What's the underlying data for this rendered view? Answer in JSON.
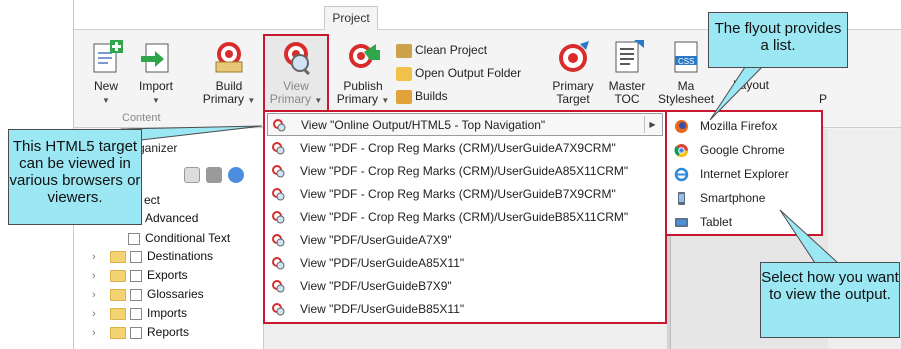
{
  "ribbon": {
    "tab_label": "Project",
    "buttons": {
      "new": {
        "label": "New"
      },
      "import": {
        "label": "Import"
      },
      "build": {
        "label_1": "Build",
        "label_2": "Primary"
      },
      "view": {
        "label_1": "View",
        "label_2": "Primary"
      },
      "publish": {
        "label_1": "Publish",
        "label_2": "Primary"
      },
      "primary_target": {
        "label_1": "Primary",
        "label_2": "Target"
      },
      "master_toc": {
        "label_1": "Master",
        "label_2": "TOC"
      },
      "master_stylesheet": {
        "label_1": "Ma",
        "label_2": "Stylesheet"
      },
      "layout": {
        "label": "Layout"
      }
    },
    "small_commands": {
      "clean_project": "Clean Project",
      "open_output_folder": "Open Output Folder",
      "builds": "Builds"
    },
    "group_content": "Content",
    "overflow_char": "P"
  },
  "organizer": {
    "title": "ganizer",
    "tree": [
      {
        "label": "ect"
      },
      {
        "label": "Advanced"
      },
      {
        "label": "Conditional Text"
      },
      {
        "label": "Destinations"
      },
      {
        "label": "Exports"
      },
      {
        "label": "Glossaries"
      },
      {
        "label": "Imports"
      },
      {
        "label": "Reports"
      }
    ]
  },
  "view_menu": {
    "items": [
      {
        "label": "View \"Online Output/HTML5 - Top Navigation\""
      },
      {
        "label": "View \"PDF - Crop Reg Marks (CRM)/UserGuideA7X9CRM\""
      },
      {
        "label": "View \"PDF - Crop Reg Marks (CRM)/UserGuideA85X11CRM\""
      },
      {
        "label": "View \"PDF - Crop Reg Marks (CRM)/UserGuideB7X9CRM\""
      },
      {
        "label": "View \"PDF - Crop Reg Marks (CRM)/UserGuideB85X11CRM\""
      },
      {
        "label": "View \"PDF/UserGuideA7X9\""
      },
      {
        "label": "View \"PDF/UserGuideA85X11\""
      },
      {
        "label": "View \"PDF/UserGuideB7X9\""
      },
      {
        "label": "View \"PDF/UserGuideB85X11\""
      }
    ]
  },
  "browser_flyout": {
    "items": [
      {
        "label": "Mozilla Firefox",
        "icon": "firefox-icon"
      },
      {
        "label": "Google Chrome",
        "icon": "chrome-icon"
      },
      {
        "label": "Internet Explorer",
        "icon": "internet-explorer-icon"
      },
      {
        "label": "Smartphone",
        "icon": "smartphone-icon"
      },
      {
        "label": "Tablet",
        "icon": "tablet-icon"
      }
    ]
  },
  "callouts": {
    "flyout": "The flyout provides a list.",
    "html5": "This HTML5 target can be viewed in various browsers or viewers.",
    "select": "Select how you want to view the output."
  },
  "colors": {
    "highlight_red": "#c8172f",
    "callout_fill": "#9be8f4",
    "ribbon_bg": "#f4f4f4"
  }
}
